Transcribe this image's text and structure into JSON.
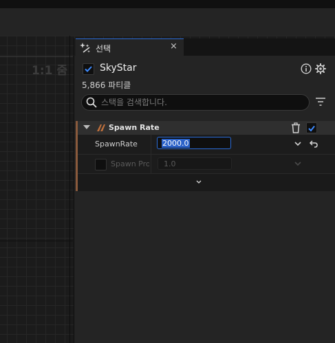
{
  "viewport": {
    "zoom_label": "1:1 줌"
  },
  "panel": {
    "tab_title": "선택",
    "tab_close": "×",
    "tab_icon": "sparkle-icon",
    "object": {
      "name": "SkyStar",
      "enabled": true,
      "count": "5,866 파티클"
    },
    "search": {
      "placeholder": "스택을 검색합니다.",
      "value": ""
    },
    "icons": {
      "info": "info-icon",
      "settings": "gear-icon",
      "filter": "filter-icon"
    }
  },
  "module": {
    "title": "Spawn Rate",
    "enabled": true,
    "accent_color": "#8a5a3c",
    "rows": [
      {
        "label": "SpawnRate",
        "value": "2000.0",
        "editing": true
      },
      {
        "label": "Spawn Pro",
        "value": "1.0",
        "enabled": false
      }
    ]
  },
  "colors": {
    "accent": "#2a6bd6",
    "check": "#3d8bff"
  }
}
